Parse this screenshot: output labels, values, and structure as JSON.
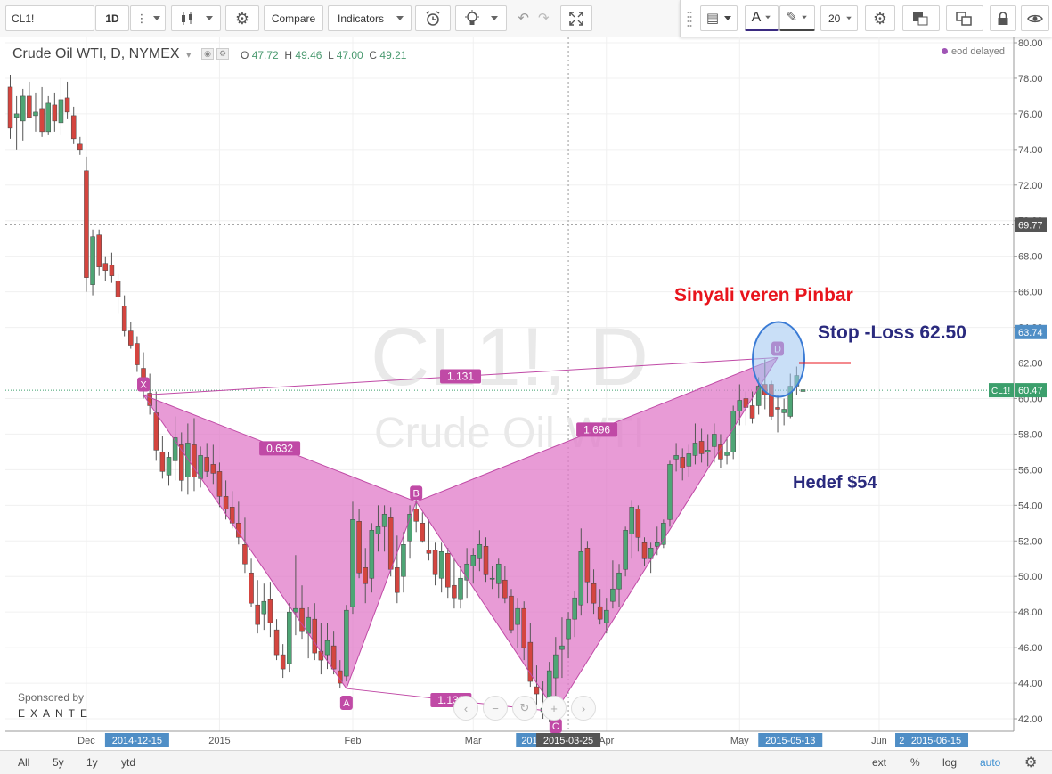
{
  "toolbar": {
    "symbol": "CL1!",
    "interval": "1D",
    "compare_label": "Compare",
    "indicators_label": "Indicators",
    "font_size_value": "20",
    "text_tool_label": "A"
  },
  "header": {
    "title": "Crude Oil WTI, D, NYMEX",
    "ohlc": [
      {
        "key": "O",
        "value": "47.72"
      },
      {
        "key": "H",
        "value": "49.46"
      },
      {
        "key": "L",
        "value": "47.00"
      },
      {
        "key": "C",
        "value": "49.21"
      }
    ],
    "status": "eod delayed"
  },
  "watermark": {
    "line1": "CL1!, D",
    "line2": "Crude Oil WTI"
  },
  "sponsor": {
    "label": "Sponsored by",
    "name": "EXANTE"
  },
  "bottom_bar": {
    "ranges": [
      "All",
      "5y",
      "1y",
      "ytd"
    ],
    "options": [
      "ext",
      "%",
      "log",
      "auto"
    ]
  },
  "colors": {
    "up": "#4ea575",
    "down": "#d4453f",
    "pattern_fill": "#e07ac8",
    "pattern_line": "#c04aa6",
    "axis_tag": "#4f8ec6",
    "price_tag": "#3c9f6c"
  },
  "chart_data": {
    "type": "candlestick",
    "symbol": "CL1!",
    "interval": "D",
    "exchange": "NYMEX",
    "title": "Crude Oil WTI, D, NYMEX",
    "ylim": [
      41,
      80
    ],
    "y_ticks": [
      42,
      44,
      46,
      48,
      50,
      52,
      54,
      56,
      58,
      60,
      62,
      64,
      66,
      68,
      70,
      72,
      74,
      76,
      78,
      80
    ],
    "x_labels": [
      {
        "label": "Dec",
        "i": 12
      },
      {
        "label": "2014-12-15",
        "i": 20,
        "tag": true
      },
      {
        "label": "2015",
        "i": 33
      },
      {
        "label": "Feb",
        "i": 54
      },
      {
        "label": "Mar",
        "i": 73
      },
      {
        "label": "2015-0",
        "i": 83,
        "tag": true
      },
      {
        "label": "2015-03-25",
        "i": 88,
        "tag": true,
        "dark": true
      },
      {
        "label": "Apr",
        "i": 94
      },
      {
        "label": "May",
        "i": 115
      },
      {
        "label": "2015-05-13",
        "i": 123,
        "tag": true
      },
      {
        "label": "Jun",
        "i": 137
      },
      {
        "label": "20",
        "i": 141,
        "tag": true
      },
      {
        "label": "2015-06-15",
        "i": 146,
        "tag": true
      }
    ],
    "price_tags": [
      {
        "value": 69.77,
        "label": "69.77",
        "style": "dark"
      },
      {
        "value": 63.74,
        "label": "63.74",
        "style": "blue"
      },
      {
        "value": 60.47,
        "label": "60.47",
        "prefix": "CL1!",
        "style": "green"
      }
    ],
    "crosshair": {
      "price": 69.77,
      "i": 88
    },
    "last_price": 60.47,
    "ohlc": [
      [
        77.5,
        78.2,
        74.6,
        75.2
      ],
      [
        75.8,
        77.0,
        74.0,
        76.0
      ],
      [
        75.6,
        77.4,
        74.5,
        77.0
      ],
      [
        77.0,
        77.8,
        75.8,
        75.8
      ],
      [
        75.9,
        77.2,
        75.0,
        76.1
      ],
      [
        76.3,
        77.5,
        74.7,
        75.0
      ],
      [
        75.0,
        77.0,
        74.8,
        76.6
      ],
      [
        76.5,
        77.2,
        75.0,
        75.6
      ],
      [
        75.5,
        78.0,
        74.8,
        76.8
      ],
      [
        76.9,
        77.8,
        75.7,
        76.1
      ],
      [
        75.9,
        76.4,
        74.3,
        74.6
      ],
      [
        74.3,
        74.7,
        73.7,
        74.0
      ],
      [
        72.8,
        73.6,
        66.0,
        66.8
      ],
      [
        66.4,
        69.5,
        65.8,
        69.1
      ],
      [
        69.2,
        69.5,
        66.9,
        67.4
      ],
      [
        67.6,
        68.0,
        66.6,
        67.2
      ],
      [
        67.5,
        68.2,
        66.5,
        66.9
      ],
      [
        66.6,
        67.0,
        64.8,
        65.7
      ],
      [
        65.2,
        65.8,
        63.5,
        63.8
      ],
      [
        63.8,
        64.3,
        62.8,
        63.0
      ],
      [
        63.1,
        63.5,
        61.5,
        61.9
      ],
      [
        61.7,
        62.6,
        60.0,
        60.6
      ],
      [
        60.3,
        61.4,
        59.1,
        59.6
      ],
      [
        59.2,
        60.4,
        56.5,
        57.1
      ],
      [
        57.0,
        57.9,
        55.5,
        55.9
      ],
      [
        55.7,
        57.0,
        55.1,
        56.7
      ],
      [
        56.5,
        59.0,
        55.4,
        57.8
      ],
      [
        57.4,
        58.1,
        54.8,
        55.4
      ],
      [
        55.6,
        58.6,
        54.6,
        57.5
      ],
      [
        57.4,
        58.9,
        54.8,
        55.6
      ],
      [
        55.5,
        57.3,
        55.0,
        56.8
      ],
      [
        56.7,
        57.5,
        55.6,
        55.9
      ],
      [
        56.3,
        57.4,
        55.2,
        55.8
      ],
      [
        55.9,
        56.4,
        53.9,
        54.5
      ],
      [
        54.5,
        55.4,
        53.2,
        53.8
      ],
      [
        53.9,
        54.8,
        52.7,
        53.0
      ],
      [
        53.0,
        54.2,
        51.8,
        52.2
      ],
      [
        51.8,
        53.3,
        50.2,
        50.7
      ],
      [
        50.2,
        51.0,
        48.3,
        48.5
      ],
      [
        48.4,
        49.8,
        46.8,
        47.3
      ],
      [
        47.9,
        49.6,
        47.0,
        48.6
      ],
      [
        48.7,
        49.7,
        46.6,
        47.4
      ],
      [
        47.0,
        47.6,
        45.3,
        45.6
      ],
      [
        45.6,
        46.2,
        44.3,
        44.8
      ],
      [
        45.1,
        48.5,
        44.6,
        48.0
      ],
      [
        48.0,
        51.2,
        46.7,
        48.2
      ],
      [
        48.2,
        49.5,
        46.5,
        46.9
      ],
      [
        46.8,
        48.3,
        45.4,
        47.7
      ],
      [
        47.6,
        48.5,
        45.3,
        45.7
      ],
      [
        45.8,
        47.4,
        44.5,
        45.3
      ],
      [
        45.6,
        47.4,
        44.8,
        46.4
      ],
      [
        46.1,
        46.9,
        44.5,
        44.8
      ],
      [
        44.7,
        45.3,
        43.7,
        44.0
      ],
      [
        44.4,
        48.4,
        44.1,
        48.1
      ],
      [
        48.3,
        54.2,
        47.9,
        53.2
      ],
      [
        53.1,
        53.8,
        49.9,
        50.2
      ],
      [
        50.5,
        51.6,
        48.5,
        49.6
      ],
      [
        49.9,
        53.0,
        49.1,
        52.6
      ],
      [
        52.4,
        54.0,
        51.4,
        52.8
      ],
      [
        52.8,
        54.0,
        51.4,
        53.5
      ],
      [
        53.3,
        53.9,
        50.0,
        50.4
      ],
      [
        50.5,
        52.3,
        48.5,
        49.1
      ],
      [
        50.0,
        52.5,
        49.1,
        51.8
      ],
      [
        52.0,
        54.0,
        51.0,
        53.5
      ],
      [
        53.8,
        54.3,
        52.5,
        53.1
      ],
      [
        53.0,
        53.6,
        51.9,
        52.0
      ],
      [
        51.5,
        53.2,
        50.9,
        51.3
      ],
      [
        51.5,
        51.9,
        49.5,
        50.1
      ],
      [
        49.9,
        51.9,
        49.1,
        51.4
      ],
      [
        51.3,
        51.6,
        48.8,
        49.4
      ],
      [
        49.5,
        51.0,
        48.2,
        48.8
      ],
      [
        48.7,
        50.6,
        48.2,
        49.9
      ],
      [
        49.8,
        51.6,
        48.8,
        50.7
      ],
      [
        50.6,
        51.6,
        49.6,
        51.2
      ],
      [
        51.0,
        52.6,
        50.3,
        51.8
      ],
      [
        51.7,
        52.2,
        49.7,
        50.1
      ],
      [
        49.9,
        50.6,
        49.3,
        49.9
      ],
      [
        49.6,
        51.0,
        48.8,
        50.7
      ],
      [
        49.8,
        50.6,
        48.5,
        48.8
      ],
      [
        48.9,
        49.3,
        46.8,
        47.0
      ],
      [
        47.3,
        48.8,
        46.0,
        48.2
      ],
      [
        48.2,
        48.6,
        45.3,
        46.0
      ],
      [
        46.3,
        47.4,
        43.8,
        44.1
      ],
      [
        43.8,
        45.0,
        42.8,
        43.4
      ],
      [
        42.4,
        44.1,
        42.0,
        42.6
      ],
      [
        42.3,
        45.2,
        41.8,
        44.7
      ],
      [
        44.3,
        46.6,
        43.3,
        45.6
      ],
      [
        45.9,
        47.7,
        44.3,
        46.1
      ],
      [
        46.5,
        48.0,
        45.4,
        47.6
      ],
      [
        47.6,
        49.2,
        46.6,
        48.8
      ],
      [
        48.4,
        52.7,
        47.8,
        51.4
      ],
      [
        51.6,
        52.0,
        48.5,
        49.7
      ],
      [
        49.6,
        50.4,
        47.9,
        48.5
      ],
      [
        48.3,
        49.3,
        47.3,
        47.6
      ],
      [
        47.4,
        48.8,
        46.8,
        48.1
      ],
      [
        48.6,
        50.9,
        48.2,
        49.3
      ],
      [
        49.3,
        50.7,
        48.3,
        50.2
      ],
      [
        50.4,
        52.8,
        50.0,
        52.6
      ],
      [
        52.4,
        54.3,
        51.0,
        53.9
      ],
      [
        53.8,
        54.0,
        51.4,
        52.2
      ],
      [
        51.9,
        52.2,
        50.6,
        51.0
      ],
      [
        51.0,
        51.9,
        50.2,
        51.6
      ],
      [
        51.7,
        52.8,
        51.2,
        51.9
      ],
      [
        51.8,
        53.2,
        51.6,
        53.0
      ],
      [
        53.2,
        56.5,
        52.8,
        56.3
      ],
      [
        56.6,
        57.5,
        55.9,
        56.8
      ],
      [
        56.7,
        57.2,
        55.4,
        56.1
      ],
      [
        56.2,
        57.4,
        55.6,
        56.9
      ],
      [
        56.8,
        58.6,
        56.3,
        57.5
      ],
      [
        57.6,
        58.3,
        56.4,
        56.9
      ],
      [
        57.0,
        58.0,
        56.2,
        57.1
      ],
      [
        57.3,
        58.6,
        56.4,
        58.0
      ],
      [
        57.4,
        58.0,
        56.1,
        56.6
      ],
      [
        56.8,
        57.8,
        56.3,
        57.0
      ],
      [
        57.0,
        59.6,
        56.6,
        59.3
      ],
      [
        59.3,
        60.8,
        58.5,
        59.9
      ],
      [
        60.0,
        60.4,
        58.5,
        59.5
      ],
      [
        59.6,
        60.4,
        58.6,
        58.9
      ],
      [
        59.6,
        61.2,
        59.1,
        60.7
      ],
      [
        60.8,
        62.2,
        59.4,
        60.2
      ],
      [
        60.8,
        61.0,
        58.8,
        59.0
      ],
      [
        59.5,
        60.2,
        58.1,
        59.4
      ],
      [
        59.2,
        60.0,
        58.5,
        59.4
      ],
      [
        59.0,
        61.4,
        58.9,
        60.7
      ],
      [
        60.7,
        61.8,
        60.2,
        61.3
      ],
      [
        60.4,
        61.3,
        60.0,
        60.5
      ]
    ],
    "harmonic_pattern": {
      "name": "Bat",
      "points": [
        {
          "label": "X",
          "i": 21,
          "price": 60.2
        },
        {
          "label": "A",
          "i": 53,
          "price": 43.7
        },
        {
          "label": "B",
          "i": 64,
          "price": 54.2
        },
        {
          "label": "C",
          "i": 86,
          "price": 42.4
        },
        {
          "label": "D",
          "i": 121,
          "price": 62.3
        }
      ],
      "ratios": [
        {
          "value": "0.632",
          "between": [
            "X",
            "B"
          ]
        },
        {
          "value": "1.133",
          "between": [
            "A",
            "C"
          ]
        },
        {
          "value": "1.696",
          "between": [
            "B",
            "D"
          ]
        },
        {
          "value": "1.131",
          "between": [
            "X",
            "D"
          ]
        }
      ]
    },
    "annotations": [
      {
        "id": "signal",
        "text": "Sinyali veren Pinbar",
        "color": "#e8141c"
      },
      {
        "id": "stop",
        "text": "Stop -Loss 62.50",
        "color": "#2a2a7e",
        "price": 62.5
      },
      {
        "id": "target",
        "text": "Hedef $54",
        "color": "#2a2a7e",
        "price": 54
      }
    ]
  }
}
